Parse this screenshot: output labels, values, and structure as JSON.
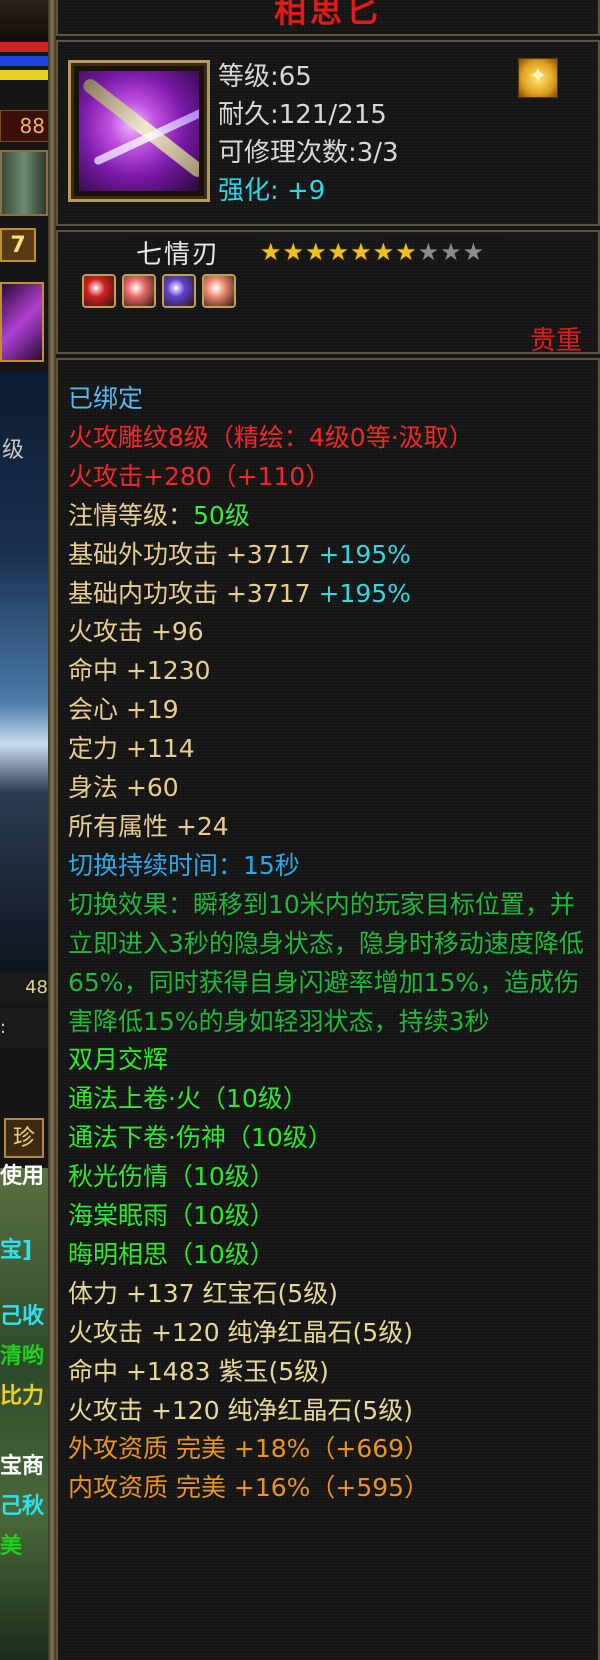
{
  "left_strip": {
    "level_value": "88",
    "btn_label": "7",
    "scene_text": "级",
    "row_value_1": "48",
    "row_value_2": ":",
    "tab_label": "珍",
    "map_texts": [
      "使用",
      "宝]",
      "己收",
      "清哟",
      "比力",
      "宝商",
      "己秋",
      "美"
    ],
    "colors": {
      "hp": "#d42020",
      "mp": "#2040e0",
      "exp": "#e8d020"
    }
  },
  "tooltip": {
    "title": "相思匕",
    "level": "等级:65",
    "durability": "耐久:121/215",
    "repairs": "可修理次数:3/3",
    "enhance": "强化: +9",
    "badge_icon": "gold-emblem-icon",
    "name": "七情刃",
    "stars_total": 10,
    "stars_filled": 7,
    "gems": [
      {
        "name": "red-gem-icon",
        "color": "#d02020"
      },
      {
        "name": "pink-gem-icon",
        "color": "#e86a6a"
      },
      {
        "name": "purple-gem-icon",
        "color": "#6040d0"
      },
      {
        "name": "pink-gem-icon",
        "color": "#f08a70"
      }
    ],
    "rarity": "贵重",
    "stats": [
      {
        "text": "已绑定",
        "cls": "c-cyan"
      },
      {
        "text": "火攻雕纹8级（精绘：4级0等·汲取）",
        "cls": "c-red"
      },
      {
        "text": "火攻击+280（+110）",
        "cls": "c-red"
      },
      {
        "text_a": "注情等级：",
        "text_b": "50级",
        "cls_a": "c-tan",
        "cls_b": "c-lgreen"
      },
      {
        "text_a": "基础外功攻击 +3717 ",
        "text_b": "+195%",
        "cls_a": "c-tan",
        "cls_b": "c-teal"
      },
      {
        "text_a": "基础内功攻击 +3717 ",
        "text_b": "+195%",
        "cls_a": "c-tan",
        "cls_b": "c-teal"
      },
      {
        "text": "火攻击 +96",
        "cls": "c-tan"
      },
      {
        "text": "命中 +1230",
        "cls": "c-tan"
      },
      {
        "text": "会心 +19",
        "cls": "c-tan"
      },
      {
        "text": "定力 +114",
        "cls": "c-tan"
      },
      {
        "text": "身法 +60",
        "cls": "c-tan"
      },
      {
        "text": "所有属性 +24",
        "cls": "c-tan"
      },
      {
        "text": "切换持续时间：15秒",
        "cls": "c-blue"
      },
      {
        "text": "切换效果：瞬移到10米内的玩家目标位置，并立即进入3秒的隐身状态，隐身时移动速度降低65%，同时获得自身闪避率增加15%，造成伤害降低15%的身如轻羽状态，持续3秒",
        "cls": "c-dgreen",
        "wrap": true
      },
      {
        "text": "双月交辉",
        "cls": "c-bgreen"
      },
      {
        "text": "通法上卷·火（10级）",
        "cls": "c-bgreen"
      },
      {
        "text": "通法下卷·伤神（10级）",
        "cls": "c-bgreen"
      },
      {
        "text": "秋光伤情（10级）",
        "cls": "c-bgreen"
      },
      {
        "text": "海棠眠雨（10级）",
        "cls": "c-bgreen"
      },
      {
        "text": "晦明相思（10级）",
        "cls": "c-bgreen"
      },
      {
        "text": "体力 +137 红宝石(5级)",
        "cls": "c-yellow"
      },
      {
        "text": "火攻击 +120 纯净红晶石(5级)",
        "cls": "c-yellow"
      },
      {
        "text": "命中 +1483 紫玉(5级)",
        "cls": "c-yellow"
      },
      {
        "text": "火攻击 +120 纯净红晶石(5级)",
        "cls": "c-yellow"
      },
      {
        "text": "外攻资质  完美 +18%（+669）",
        "cls": "c-orange"
      },
      {
        "text": "内攻资质  完美 +16%（+595）",
        "cls": "c-orange"
      }
    ]
  }
}
